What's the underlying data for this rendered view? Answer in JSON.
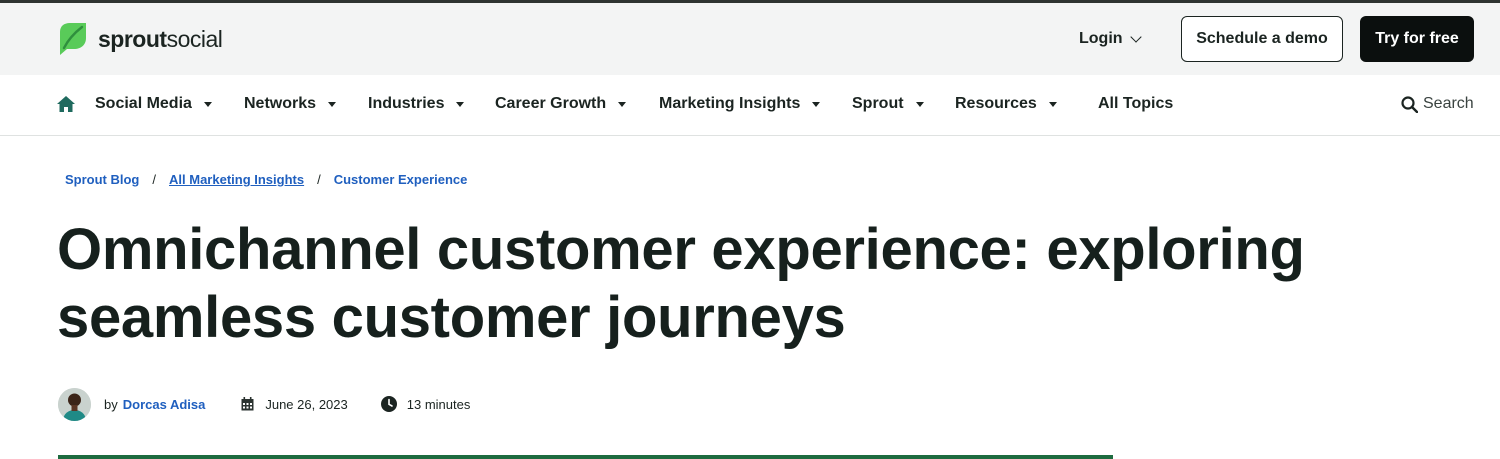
{
  "brand": {
    "name_bold": "sprout",
    "name_regular": "social",
    "color": "#59cb59"
  },
  "header": {
    "login_label": "Login",
    "demo_label": "Schedule a demo",
    "try_label": "Try for free"
  },
  "nav": {
    "items": [
      {
        "label": "Social Media"
      },
      {
        "label": "Networks"
      },
      {
        "label": "Industries"
      },
      {
        "label": "Career Growth"
      },
      {
        "label": "Marketing Insights"
      },
      {
        "label": "Sprout"
      },
      {
        "label": "Resources"
      },
      {
        "label": "All Topics"
      }
    ],
    "search_label": "Search",
    "accent": "#1f6a5e"
  },
  "breadcrumb": {
    "items": [
      {
        "label": "Sprout Blog"
      },
      {
        "label": "All Marketing Insights"
      },
      {
        "label": "Customer Experience"
      }
    ],
    "separator": "/"
  },
  "article": {
    "title_line1": "Omnichannel customer experience: exploring",
    "title_line2": "seamless customer journeys",
    "by_label": "by",
    "author": "Dorcas Adisa",
    "date": "June 26, 2023",
    "read_time": "13 minutes"
  },
  "colors": {
    "link": "#1f5fbf",
    "divider": "#1d6b3f"
  }
}
